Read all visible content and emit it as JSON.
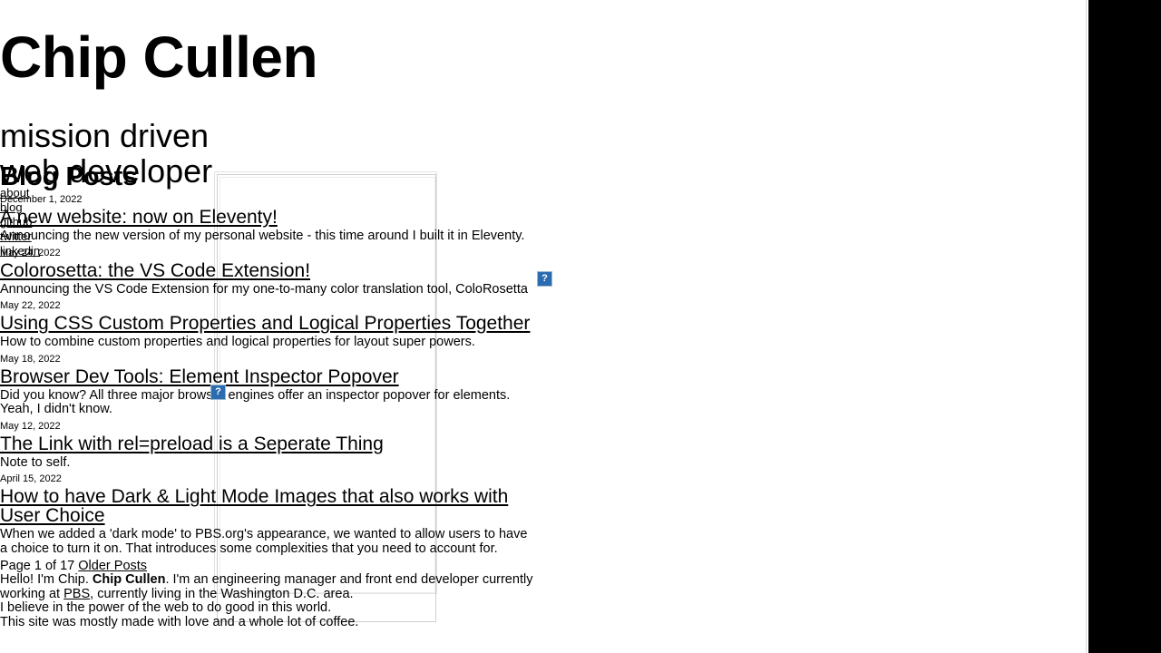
{
  "site": {
    "title": "Chip Cullen",
    "tagline": "mission driven web developer"
  },
  "nav": {
    "items": [
      {
        "label": "about"
      },
      {
        "label": "blog"
      },
      {
        "label": "github"
      },
      {
        "label": "twitter"
      },
      {
        "label": "linkedin"
      }
    ]
  },
  "main": {
    "heading": "Blog Posts",
    "posts": [
      {
        "date": "December 1, 2022",
        "title": "A new website: now on Eleventy!",
        "excerpt": "Announcing the new version of my personal website - this time around I built it in Eleventy."
      },
      {
        "date": "May 24, 2022",
        "title": "Colorosetta: the VS Code Extension!",
        "excerpt": "Announcing the VS Code Extension for my one-to-many color translation tool, ColoRosetta"
      },
      {
        "date": "May 22, 2022",
        "title": "Using CSS Custom Properties and Logical Properties Together",
        "excerpt": "How to combine custom properties and logical properties for layout super powers."
      },
      {
        "date": "May 18, 2022",
        "title": "Browser Dev Tools: Element Inspector Popover",
        "excerpt": "Did you know? All three major browser engines offer an inspector popover for elements. Yeah, I didn't know."
      },
      {
        "date": "May 12, 2022",
        "title": "The Link with rel=preload is a Seperate Thing",
        "excerpt": "Note to self."
      },
      {
        "date": "April 15, 2022",
        "title": "How to have Dark & Light Mode Images that also works with User Choice",
        "excerpt": "When we added a 'dark mode' to PBS.org's appearance, we wanted to allow users to have a choice to turn it on. That introduces some complexities that you need to account for."
      }
    ],
    "pagination": {
      "page_label": "Page 1 of 17",
      "older_link": "Older Posts"
    }
  },
  "bio": {
    "line1_pre": "Hello! I'm Chip. ",
    "line1_name": "Chip Cullen",
    "line1_mid": ". I'm an engineering manager and front end developer currently working at ",
    "line1_link": "PBS",
    "line1_post": ", currently living in the Washington D.C. area.",
    "line2": "I believe in the power of the web to do good in this world.",
    "line3_clipped": "This site was mostly made with love and a whole lot of coffee."
  },
  "placeholders": {
    "glyph": "?",
    "icon_name": "broken-image-icon"
  },
  "colors": {
    "page_background": "#ffffff",
    "text": "#000000",
    "gutter": "#000000",
    "box_border": "#cfcfcf",
    "placeholder_blue": "#2b6cb0"
  }
}
